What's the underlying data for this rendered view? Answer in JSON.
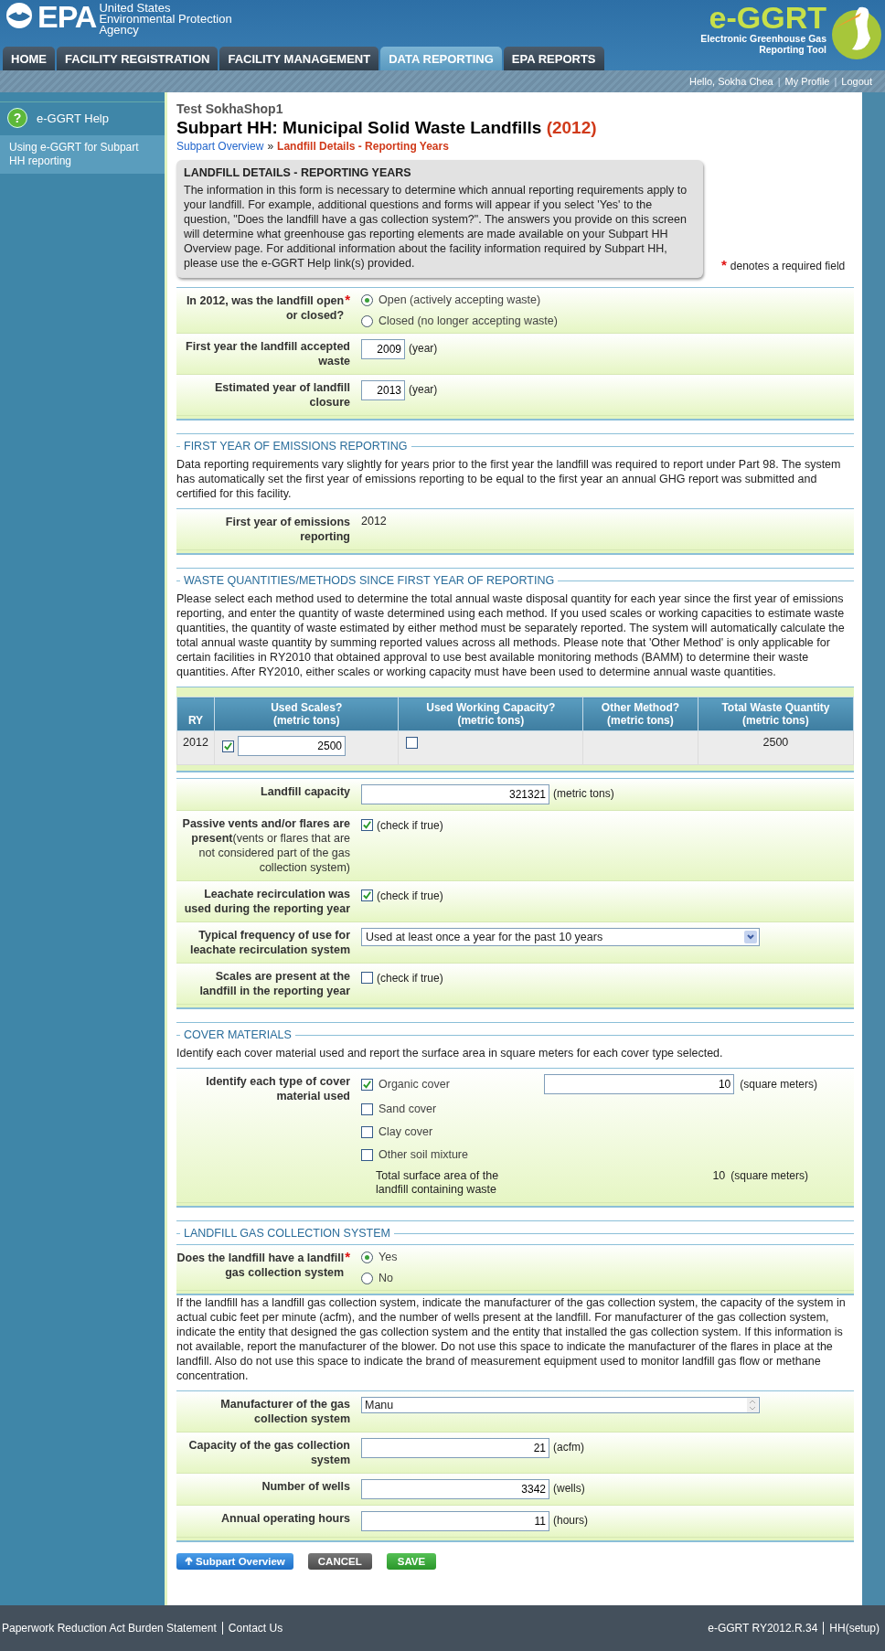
{
  "header": {
    "agency_logo": "EPA",
    "agency_name": [
      "United States",
      "Environmental Protection",
      "Agency"
    ],
    "app_logo": "e-GGRT",
    "app_name": [
      "Electronic Greenhouse Gas",
      "Reporting Tool"
    ]
  },
  "tabs": [
    {
      "label": "HOME",
      "selected": false
    },
    {
      "label": "FACILITY REGISTRATION",
      "selected": false
    },
    {
      "label": "FACILITY MANAGEMENT",
      "selected": false
    },
    {
      "label": "DATA REPORTING",
      "selected": true
    },
    {
      "label": "EPA REPORTS",
      "selected": false
    }
  ],
  "user_bar": {
    "greeting": "Hello, Sokha Chea",
    "separator": "|",
    "links": [
      "My Profile",
      "Logout"
    ]
  },
  "sidebar": {
    "help_icon": "?",
    "help_title": "e-GGRT Help",
    "links": [
      "Using e-GGRT for Subpart HH reporting"
    ]
  },
  "page": {
    "facility": "Test SokhaShop1",
    "title": "Subpart HH: Municipal Solid Waste Landfills",
    "year": "(2012)",
    "separator": "»",
    "breadcrumb": [
      {
        "label": "Subpart Overview",
        "current": false
      },
      {
        "label": "Landfill Details - Reporting Years",
        "current": true
      }
    ]
  },
  "intro": {
    "title": "LANDFILL DETAILS - REPORTING YEARS",
    "text": "The information in this form is necessary to determine which annual reporting requirements apply to your landfill. For example, additional questions and forms will appear if you select 'Yes' to the question, \"Does the landfill have a gas collection system?\". The answers you provide on this screen will determine what greenhouse gas reporting elements are made available on your Subpart HH Overview page. For additional information about the facility information required by Subpart HH, please use the e-GGRT Help link(s) provided.",
    "required_mark": "*",
    "required_note": "denotes a required field"
  },
  "sections": [
    {
      "parts": [
        {
          "kind": "rows",
          "rows": [
            {
              "kind": "radio",
              "label": "In 2012, was the landfill open or closed?",
              "required": true,
              "options": [
                {
                  "label": "Open (actively accepting waste)",
                  "selected": true
                },
                {
                  "label": "Closed (no longer accepting waste)",
                  "selected": false
                }
              ]
            },
            {
              "kind": "year",
              "label": "First year the landfill accepted waste",
              "value": "2009",
              "unit": "(year)"
            },
            {
              "kind": "year",
              "label": "Estimated year of landfill closure",
              "value": "2013",
              "unit": "(year)"
            }
          ]
        }
      ]
    },
    {
      "title": "FIRST YEAR OF EMISSIONS REPORTING",
      "parts": [
        {
          "kind": "text",
          "text": "Data reporting requirements vary slightly for years prior to the first year the landfill was required to report under Part 98. The system has automatically set the first year of emissions reporting to be equal to the first year an annual GHG report was submitted and certified for this facility."
        },
        {
          "kind": "rows",
          "rows": [
            {
              "kind": "static",
              "label": "First year of emissions reporting",
              "value": "2012"
            }
          ]
        }
      ]
    },
    {
      "title": "WASTE QUANTITIES/METHODS SINCE FIRST YEAR OF REPORTING",
      "parts": [
        {
          "kind": "text",
          "text": "Please select each method used to determine the total annual waste disposal quantity for each year since the first year of emissions reporting, and enter the quantity of waste determined using each method. If you used scales or working capacities to estimate waste quantities, the quantity of waste estimated by either method must be separately reported. The system will automatically calculate the total annual waste quantity by summing reported values across all methods. Please note that 'Other Method' is only applicable for certain facilities in RY2010 that obtained approval to use best available monitoring methods (BAMM) to determine their waste quantities. After RY2010, either scales or working capacity must have been used to determine annual waste quantities."
        },
        {
          "kind": "table",
          "columns": [
            {
              "label": "RY"
            },
            {
              "label": "Used Scales?",
              "sub": "(metric tons)"
            },
            {
              "label": "Used Working Capacity?",
              "sub": "(metric tons)"
            },
            {
              "label": "Other Method?",
              "sub": "(metric tons)"
            },
            {
              "label": "Total Waste Quantity",
              "sub": "(metric tons)"
            }
          ],
          "rows": [
            {
              "ry": "2012",
              "scales_checked": true,
              "scales_value": "2500",
              "capacity_checked": false,
              "total": "2500"
            }
          ]
        }
      ]
    },
    {
      "parts": [
        {
          "kind": "rows",
          "rows": [
            {
              "kind": "number",
              "label": "Landfill capacity",
              "value": "321321",
              "unit": "(metric tons)"
            },
            {
              "kind": "checkbox",
              "label": "Passive vents and/or flares are present",
              "label_note": "(vents or flares that are not considered part of the gas collection system)",
              "checked": true,
              "note": "(check if true)"
            },
            {
              "kind": "checkbox",
              "label": "Leachate recirculation was used during the reporting year",
              "checked": true,
              "note": "(check if true)"
            },
            {
              "kind": "select",
              "label": "Typical frequency of use for leachate recirculation system",
              "value": "Used at least once a year for the past 10 years"
            },
            {
              "kind": "checkbox",
              "label": "Scales are present at the landfill in the reporting year",
              "checked": false,
              "note": "(check if true)"
            }
          ]
        }
      ]
    },
    {
      "title": "COVER MATERIALS",
      "parts": [
        {
          "kind": "text",
          "text": "Identify each cover material used and report the surface area in square meters for each cover type selected."
        },
        {
          "kind": "rows",
          "rows": [
            {
              "kind": "cover",
              "label": "Identify each type of cover material used",
              "options": [
                {
                  "label": "Organic cover",
                  "checked": true,
                  "value": "10",
                  "unit": "(square meters)"
                },
                {
                  "label": "Sand cover",
                  "checked": false
                },
                {
                  "label": "Clay cover",
                  "checked": false
                },
                {
                  "label": "Other soil mixture",
                  "checked": false
                }
              ],
              "total_label": "Total surface area of the landfill containing waste",
              "total_value": "10",
              "total_unit": "(square meters)"
            }
          ]
        }
      ]
    },
    {
      "title": "LANDFILL GAS COLLECTION SYSTEM",
      "parts": [
        {
          "kind": "rows",
          "rows": [
            {
              "kind": "radio",
              "label": "Does the landfill have a landfill gas collection system",
              "required": true,
              "options": [
                {
                  "label": "Yes",
                  "selected": true
                },
                {
                  "label": "No",
                  "selected": false
                }
              ]
            }
          ]
        },
        {
          "kind": "text",
          "text": "If the landfill has a landfill gas collection system, indicate the manufacturer of the gas collection system, the capacity of the system in actual cubic feet per minute (acfm), and the number of wells present at the landfill. For manufacturer of the gas collection system, indicate the entity that designed the gas collection system and the entity that installed the gas collection system. If this information is not available, report the manufacturer of the blower. Do not use this space to indicate the manufacturer of the flares in place at the landfill. Also do not use this space to indicate the brand of measurement equipment used to monitor landfill gas flow or methane concentration."
        },
        {
          "kind": "rows",
          "rows": [
            {
              "kind": "textarea",
              "label": "Manufacturer of the gas collection system",
              "value": "Manu"
            },
            {
              "kind": "number",
              "label": "Capacity of the gas collection system",
              "value": "21",
              "unit": "(acfm)"
            },
            {
              "kind": "number",
              "label": "Number of wells",
              "value": "3342",
              "unit": "(wells)"
            },
            {
              "kind": "number",
              "label": "Annual operating hours",
              "value": "11",
              "unit": "(hours)"
            }
          ]
        }
      ]
    }
  ],
  "buttons": [
    {
      "label": "Subpart Overview",
      "kind": "back"
    },
    {
      "label": "CANCEL",
      "kind": "cancel"
    },
    {
      "label": "SAVE",
      "kind": "save"
    }
  ],
  "footer": {
    "left": [
      "Paperwork Reduction Act Burden Statement",
      "Contact Us"
    ],
    "right": [
      "e-GGRT RY2012.R.34",
      "HH(setup)"
    ]
  }
}
